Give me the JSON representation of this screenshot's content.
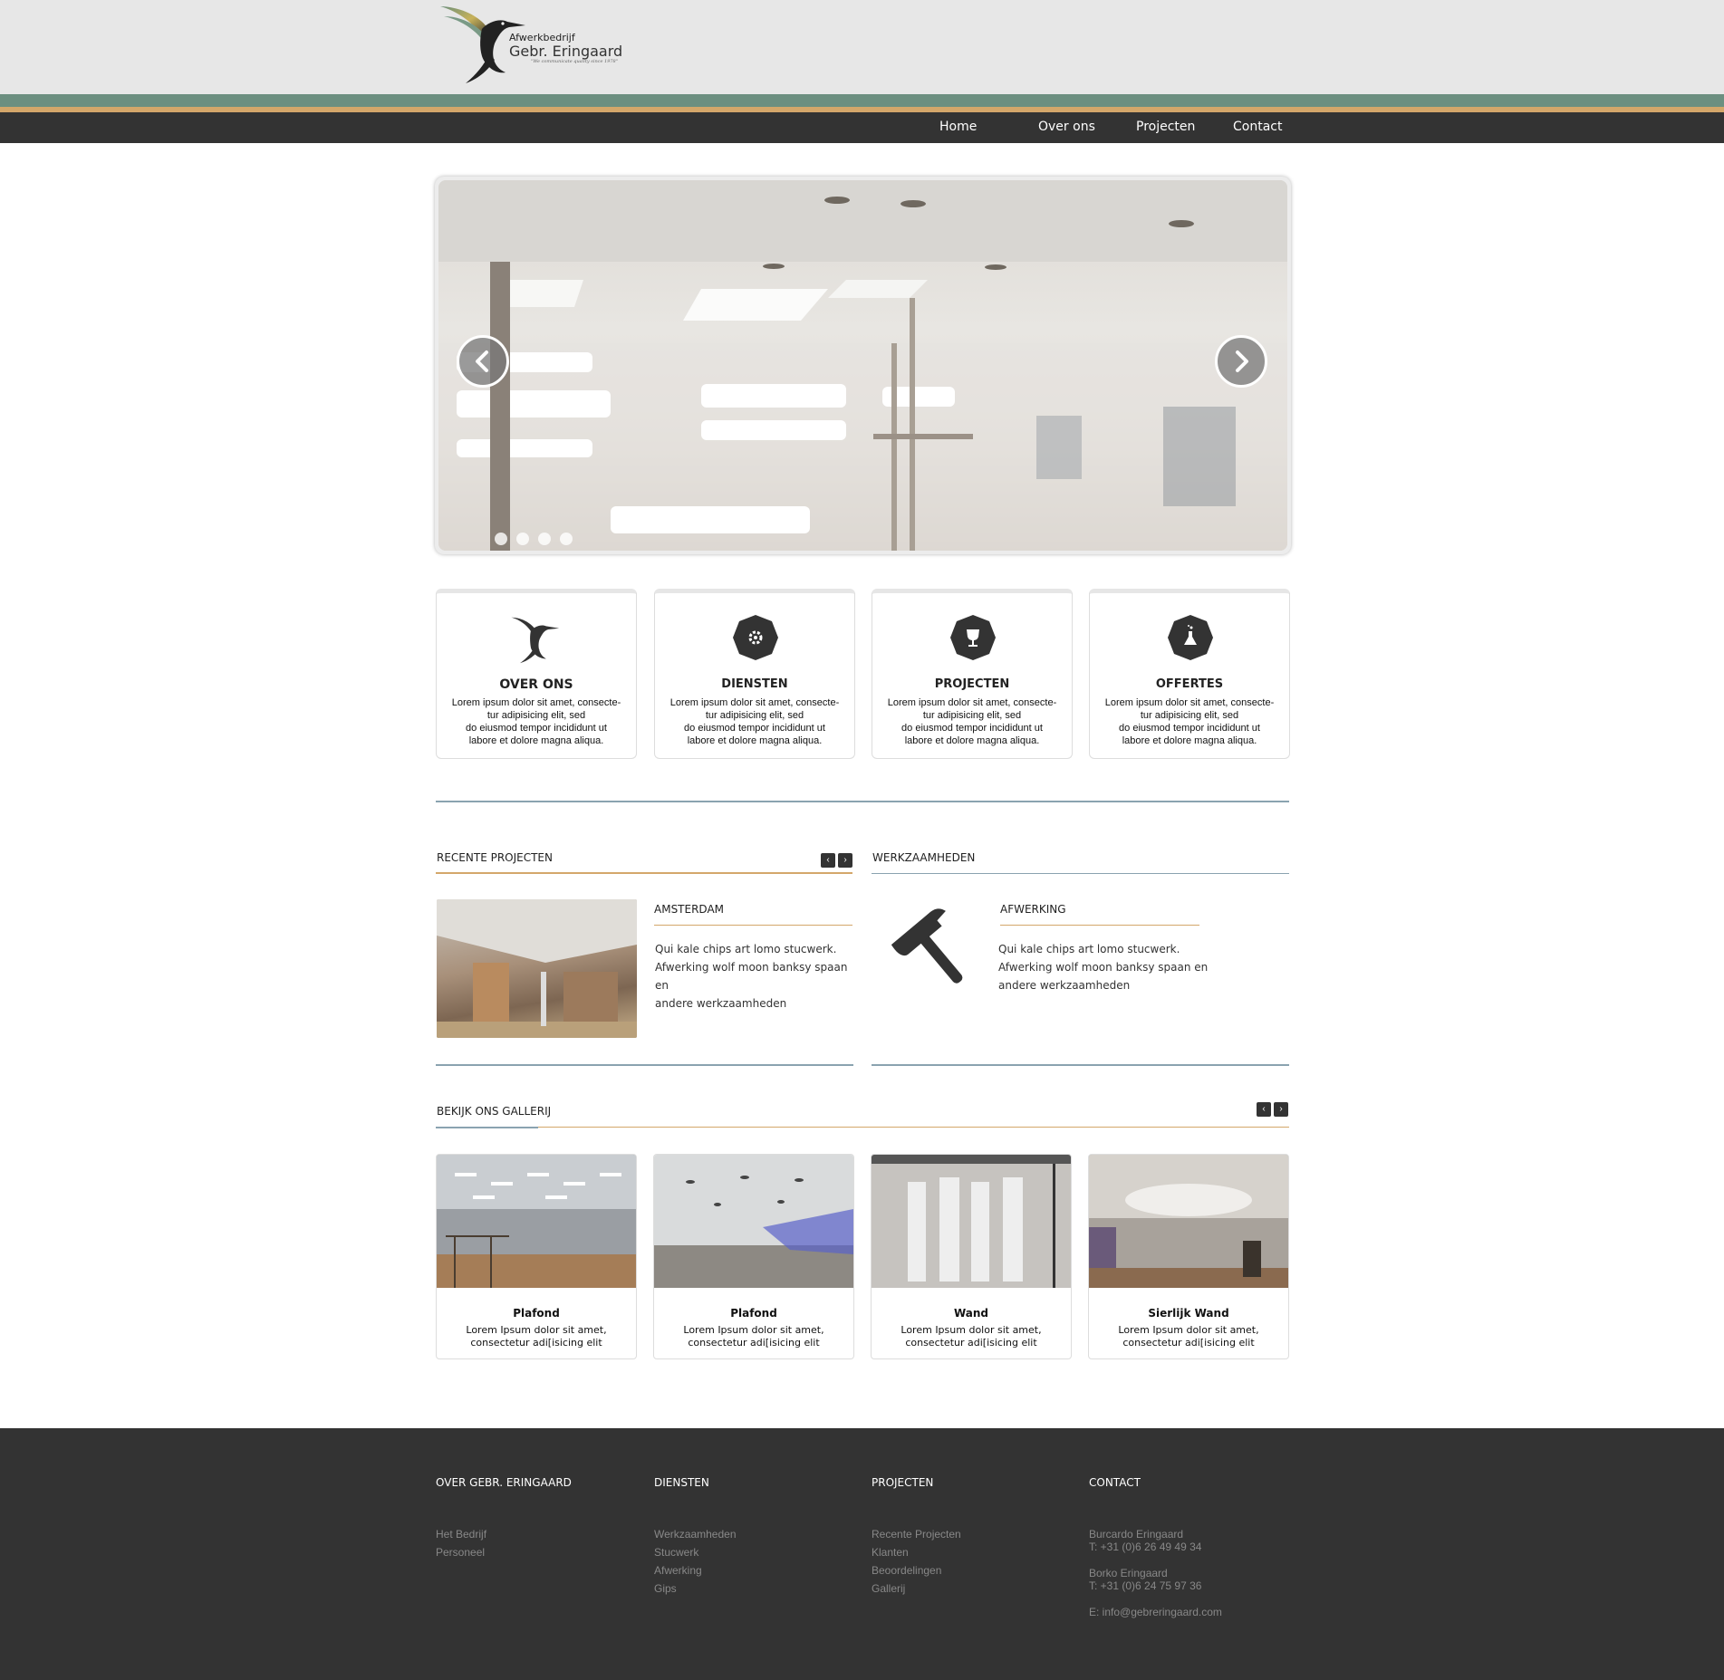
{
  "brand": {
    "title": "Afwerkbedrijf",
    "name": "Gebr. Eringaard",
    "tagline": "\"We communicate quality since 1978\""
  },
  "nav": {
    "items": [
      "Home",
      "Over ons",
      "Projecten",
      "Contact"
    ]
  },
  "slider": {
    "slide_count": 4,
    "active_index": 0
  },
  "features": [
    {
      "title": "OVER ONS",
      "icon": "hummingbird-icon",
      "text": "Lorem ipsum dolor sit amet, consecte-\ntur adipisicing elit, sed\ndo eiusmod tempor incididunt ut\nlabore et dolore magna aliqua."
    },
    {
      "title": "DIENSTEN",
      "icon": "gear-icon",
      "text": "Lorem ipsum dolor sit amet, consecte-\ntur adipisicing elit, sed\ndo eiusmod tempor incididunt ut\nlabore et dolore magna aliqua."
    },
    {
      "title": "PROJECTEN",
      "icon": "trophy-icon",
      "text": "Lorem ipsum dolor sit amet, consecte-\ntur adipisicing elit, sed\ndo eiusmod tempor incididunt ut\nlabore et dolore magna aliqua."
    },
    {
      "title": "OFFERTES",
      "icon": "flask-icon",
      "text": "Lorem ipsum dolor sit amet, consecte-\ntur adipisicing elit, sed\ndo eiusmod tempor incididunt ut\nlabore et dolore magna aliqua."
    }
  ],
  "recent": {
    "label": "RECENTE PROJECTEN",
    "prev": "‹",
    "next": "›",
    "item_title": "AMSTERDAM",
    "item_text": "Qui kale chips art lomo stucwerk.\nAfwerking wolf moon banksy spaan en\nandere werkzaamheden"
  },
  "work": {
    "label": "WERKZAAMHEDEN",
    "icon": "hammer-icon",
    "item_title": "AFWERKING",
    "item_text": "Qui kale chips art lomo stucwerk.\nAfwerking wolf moon banksy spaan en\nandere werkzaamheden"
  },
  "gallery": {
    "label": "BEKIJK ONS GALLERIJ",
    "prev": "‹",
    "next": "›",
    "items": [
      {
        "title": "Plafond",
        "text": "Lorem Ipsum dolor sit amet,\nconsectetur adi[isicing elit"
      },
      {
        "title": "Plafond",
        "text": "Lorem Ipsum dolor sit amet,\nconsectetur adi[isicing elit"
      },
      {
        "title": "Wand",
        "text": "Lorem Ipsum dolor sit amet,\nconsectetur adi[isicing elit"
      },
      {
        "title": "Sierlijk Wand",
        "text": "Lorem Ipsum dolor sit amet,\nconsectetur adi[isicing elit"
      }
    ]
  },
  "footer": {
    "col1": {
      "head": "OVER GEBR. ERINGAARD",
      "links": [
        "Het Bedrijf",
        "Personeel"
      ]
    },
    "col2": {
      "head": "DIENSTEN",
      "links": [
        "Werkzaamheden",
        "Stucwerk",
        "Afwerking",
        "Gips"
      ]
    },
    "col3": {
      "head": "PROJECTEN",
      "links": [
        "Recente Projecten",
        "Klanten",
        "Beoordelingen",
        "Gallerij"
      ]
    },
    "col4": {
      "head": "CONTACT",
      "contact1_name": "Burcardo Eringaard",
      "contact1_phone": "T: +31 (0)6  26 49 49 34",
      "contact2_name": "Borko Eringaard",
      "contact2_phone": "T: +31 (0)6 24 75 97 36",
      "email": "E: info@gebreringaard.com"
    }
  },
  "colors": {
    "header_bg": "#e7e7e7",
    "stripe_green": "#6c8f80",
    "stripe_gold": "#d4a76a",
    "nav_bg": "#333333",
    "footer_bg": "#333333"
  }
}
